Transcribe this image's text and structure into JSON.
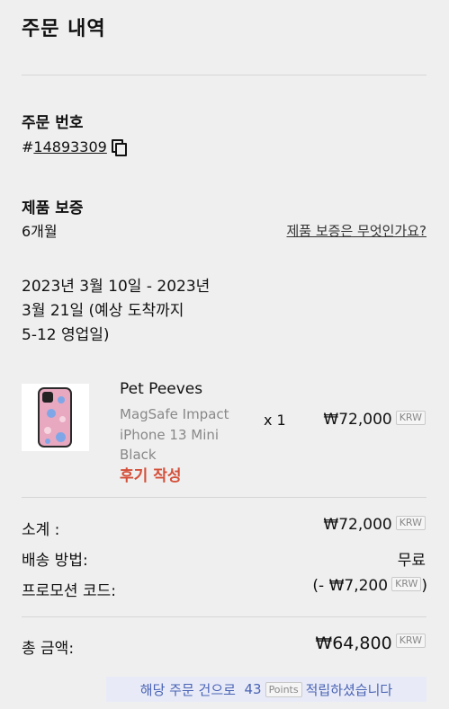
{
  "page_title": "주문 내역",
  "order": {
    "label": "주문 번호",
    "hash": "#",
    "number": "14893309"
  },
  "warranty": {
    "label": "제품 보증",
    "value": "6개월",
    "link": "제품 보증은 무엇인가요?"
  },
  "delivery": {
    "line1": "2023년 3월 10일 - 2023년",
    "line2": "3월 21일 (예상 도착까지",
    "line3": "5-12 영업일)"
  },
  "product": {
    "name": "Pet Peeves",
    "desc1": "MagSafe Impact",
    "desc2": "iPhone 13 Mini",
    "desc3": "Black",
    "review": "후기 작성",
    "quantity": "x 1",
    "price": "₩72,000",
    "currency": "KRW"
  },
  "summary": {
    "subtotal_label": "소계 :",
    "subtotal": "₩72,000",
    "currency": "KRW",
    "shipping_label": "배송 방법:",
    "shipping": "무료",
    "promo_label": "프로모션 코드:",
    "promo_open": "(- ₩7,200",
    "promo_close": ")",
    "total_label": "총 금액:",
    "total": "₩64,800"
  },
  "points": {
    "prefix": "해당 주문 건으로",
    "amount": "43",
    "badge": "Points",
    "suffix": "적립하셨습니다"
  },
  "colors": {
    "background": "#efefef",
    "review": "#d4503a",
    "points_text": "#4a63b5",
    "points_bg": "#e8ebf7"
  }
}
